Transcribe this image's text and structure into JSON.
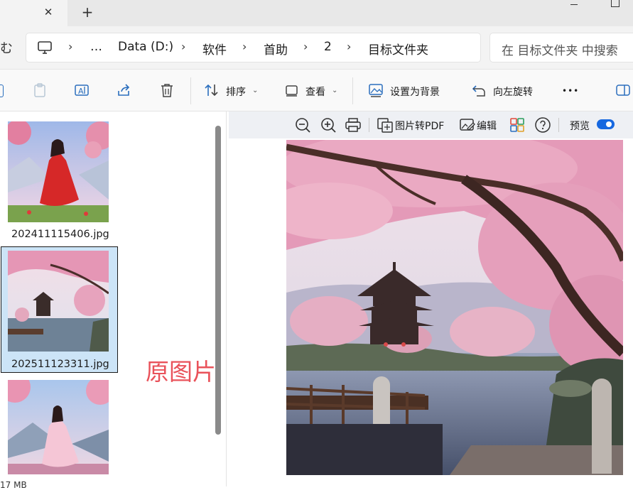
{
  "tabs": {
    "close_symbol": "✕",
    "new_tab_symbol": "+"
  },
  "address": {
    "left_cut_text": "む",
    "crumbs": [
      "…",
      "Data (D:)",
      "软件",
      "首助",
      "2",
      "目标文件夹"
    ],
    "separator": "›"
  },
  "search": {
    "placeholder": "在 目标文件夹 中搜索"
  },
  "toolbar": {
    "sort_label": "排序",
    "view_label": "查看",
    "set_background_label": "设置为背景",
    "rotate_left_label": "向左旋转",
    "more_label": "•••"
  },
  "files": [
    {
      "name": "202411115406.jpg",
      "selected": false
    },
    {
      "name": "202511123311.jpg",
      "selected": true
    },
    {
      "name": "",
      "selected": false
    }
  ],
  "annotation": {
    "text": "原图片",
    "color": "#e9525a"
  },
  "status": {
    "size_text": "17 MB"
  },
  "preview_toolbar": {
    "to_pdf_label": "图片转PDF",
    "edit_label": "编辑",
    "preview_label": "预览",
    "preview_enabled": true
  },
  "colors": {
    "accent": "#1668e0",
    "selection": "#cce4f7"
  },
  "icons": [
    "close-icon",
    "plus-icon",
    "computer-icon",
    "clipboard-icon",
    "rename-icon",
    "share-icon",
    "trash-icon",
    "sort-icon",
    "view-icon",
    "wallpaper-icon",
    "rotate-left-icon",
    "details-pane-icon",
    "zoom-out-icon",
    "zoom-in-icon",
    "print-icon",
    "pdf-icon",
    "edit-icon",
    "apps-icon",
    "help-icon"
  ]
}
